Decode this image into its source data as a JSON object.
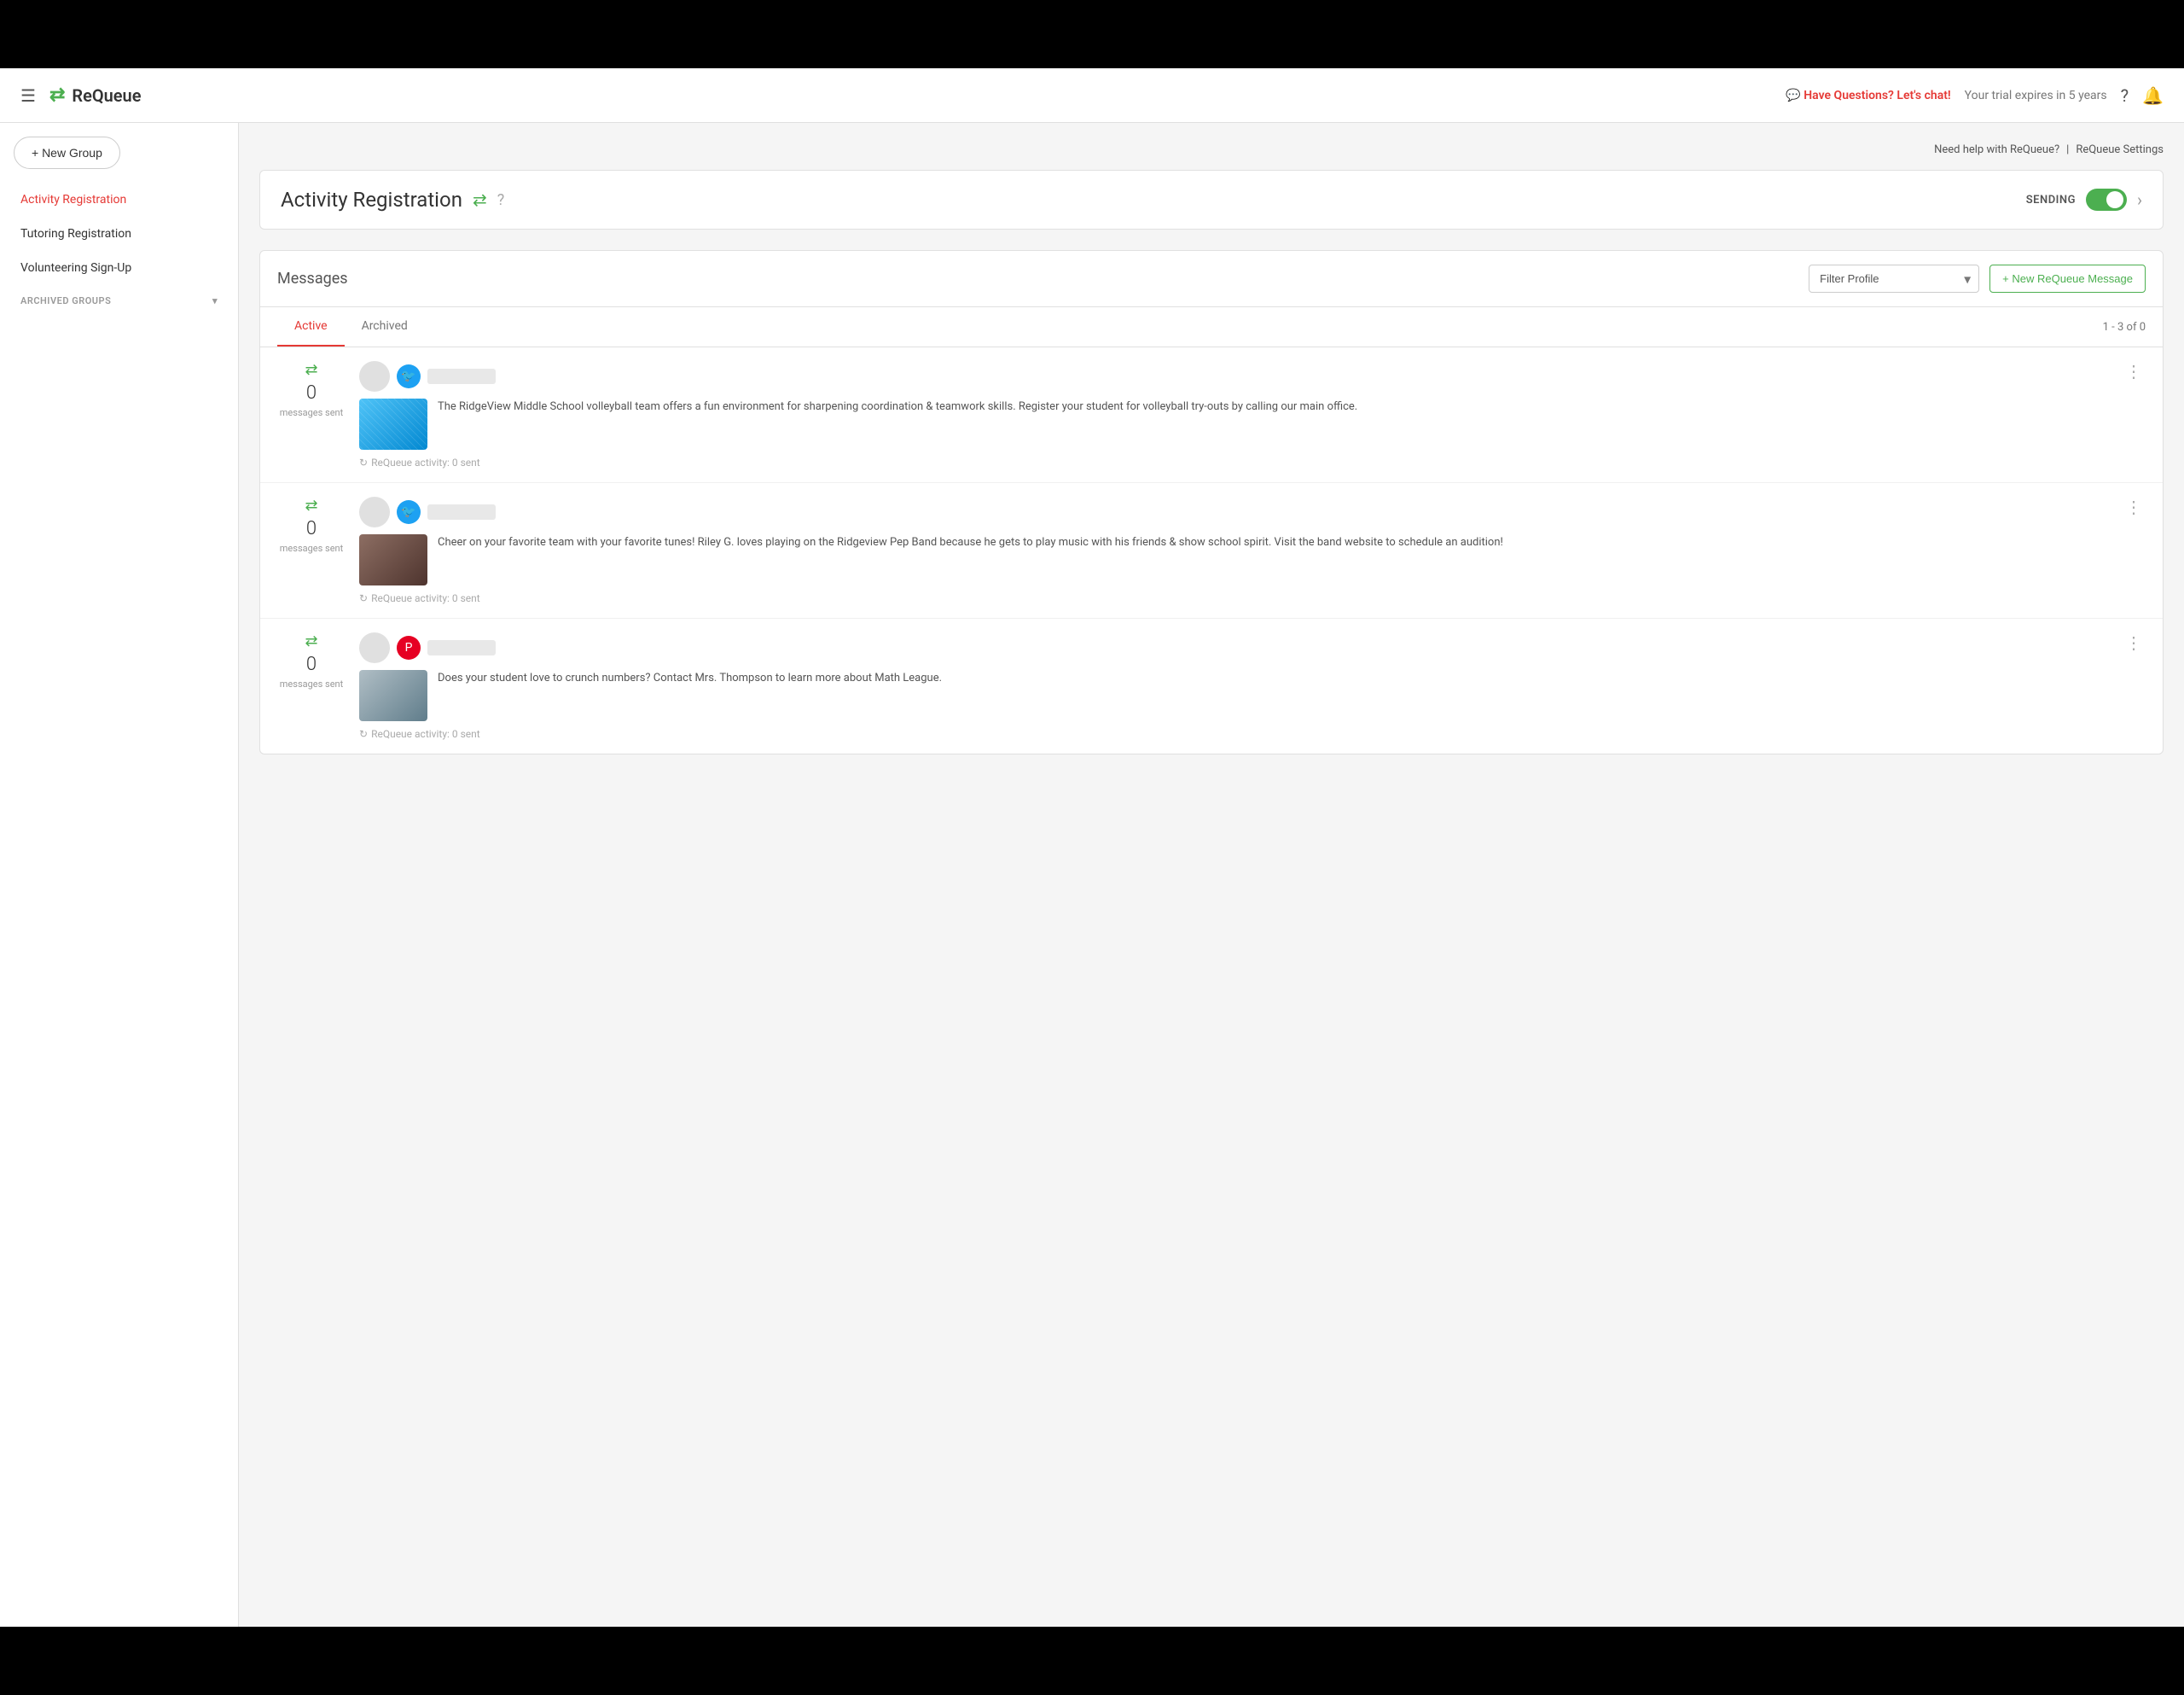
{
  "topBar": {},
  "header": {
    "hamburger": "☰",
    "logoIcon": "⇄",
    "logoText": "ReQueue",
    "chatLabel": "💬 Have Questions? Let's chat!",
    "trialText": "Your trial expires in 5 years",
    "helpIcon": "?",
    "bellIcon": "🔔"
  },
  "sidebar": {
    "newGroupLabel": "+ New Group",
    "navItems": [
      {
        "label": "Activity Registration",
        "active": true
      },
      {
        "label": "Tutoring Registration",
        "active": false
      },
      {
        "label": "Volunteering Sign-Up",
        "active": false
      }
    ],
    "archivedGroupsLabel": "ARCHIVED GROUPS",
    "archivedChevron": "▾"
  },
  "contentTopBar": {
    "helpLink": "Need help with ReQueue?",
    "separator": "|",
    "settingsLink": "ReQueue Settings"
  },
  "groupHeader": {
    "title": "Activity Registration",
    "groupIcon": "⇄",
    "helpIcon": "?",
    "sendingLabel": "SENDING",
    "chevronRight": "›"
  },
  "messagesSection": {
    "title": "Messages",
    "filterPlaceholder": "Filter Profile",
    "newMessageLabel": "+ New ReQueue Message",
    "tabs": [
      {
        "label": "Active",
        "active": true
      },
      {
        "label": "Archived",
        "active": false
      }
    ],
    "paginationText": "1 - 3 of 0",
    "messages": [
      {
        "count": "0",
        "sentLabel": "messages sent",
        "socialType": "twitter",
        "text": "The RidgeView Middle School volleyball team offers a fun environment for sharpening coordination & teamwork skills. Register your student for volleyball try-outs by calling our main office.",
        "activityText": "ReQueue activity: 0 sent",
        "imageType": "volleyball"
      },
      {
        "count": "0",
        "sentLabel": "messages sent",
        "socialType": "twitter",
        "text": "Cheer on your favorite team with your favorite tunes! Riley G. loves playing on the Ridgeview Pep Band because he gets to play music with his friends & show school spirit. Visit the band website to schedule an audition!",
        "activityText": "ReQueue activity: 0 sent",
        "imageType": "band"
      },
      {
        "count": "0",
        "sentLabel": "messages sent",
        "socialType": "pinterest",
        "text": "Does your student love to crunch numbers? Contact Mrs. Thompson to learn more about Math League.",
        "activityText": "ReQueue activity: 0 sent",
        "imageType": "math"
      }
    ]
  }
}
